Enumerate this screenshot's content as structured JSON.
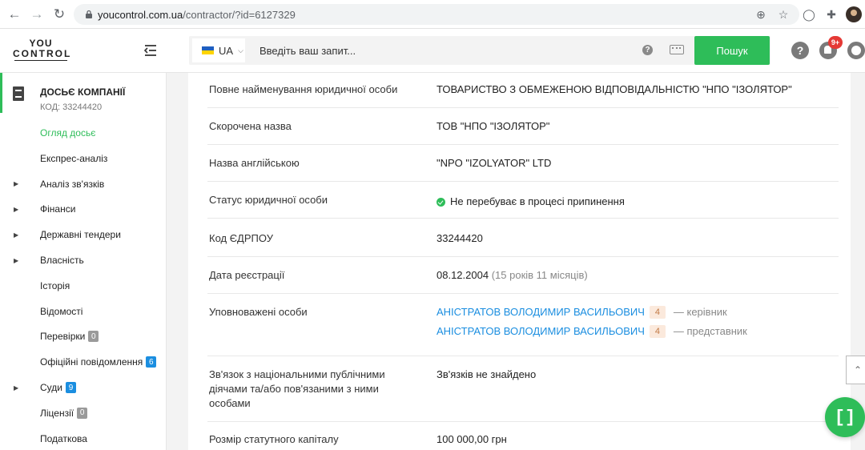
{
  "browser": {
    "url_domain": "youcontrol.com.ua",
    "url_path": "/contractor/?id=6127329"
  },
  "header": {
    "logo_line1": "YOU",
    "logo_line2": "CONTROL",
    "lang": "UA",
    "search_placeholder": "Введіть ваш запит...",
    "search_button": "Пошук",
    "help_symbol": "?",
    "notifications_badge": "9+"
  },
  "sidebar": {
    "title": "ДОСЬЄ КОМПАНІЇ",
    "code": "КОД: 33244420",
    "items": [
      {
        "label": "Огляд досьє",
        "active": true,
        "expandable": false
      },
      {
        "label": "Експрес-аналіз",
        "expandable": false
      },
      {
        "label": "Аналіз зв'язків",
        "expandable": true
      },
      {
        "label": "Фінанси",
        "expandable": true
      },
      {
        "label": "Державні тендери",
        "expandable": true
      },
      {
        "label": "Власність",
        "expandable": true
      },
      {
        "label": "Історія",
        "expandable": false
      },
      {
        "label": "Відомості",
        "expandable": false
      },
      {
        "label": "Перевірки",
        "badge": "0",
        "badge_color": "grey",
        "expandable": false
      },
      {
        "label": "Офіційні повідомлення",
        "badge": "6",
        "badge_color": "blue",
        "expandable": false
      },
      {
        "label": "Суди",
        "badge": "9",
        "badge_color": "blue",
        "expandable": true
      },
      {
        "label": "Ліцензії",
        "badge": "0",
        "badge_color": "grey",
        "expandable": false
      },
      {
        "label": "Податкова",
        "expandable": false
      }
    ]
  },
  "main": {
    "rows": [
      {
        "label": "Повне найменування юридичної особи",
        "value": "ТОВАРИСТВО З ОБМЕЖЕНОЮ ВІДПОВІДАЛЬНІСТЮ \"НПО \"ІЗОЛЯТОР\""
      },
      {
        "label": "Скорочена назва",
        "value": "ТОВ \"НПО \"ІЗОЛЯТОР\""
      },
      {
        "label": "Назва англійською",
        "value": "\"NPO \"IZOLYATOR\" LTD"
      },
      {
        "label": "Статус юридичної особи",
        "value": "Не перебуває в процесі припинення"
      },
      {
        "label": "Код ЄДРПОУ",
        "value": "33244420"
      },
      {
        "label": "Дата реєстрації",
        "value": "08.12.2004",
        "extra": "(15 років 11 місяців)"
      },
      {
        "label": "Уповноважені особи",
        "persons": [
          {
            "name": "АНІСТРАТОВ ВОЛОДИМИР ВАСИЛЬОВИЧ",
            "count": "4",
            "role": "— керівник"
          },
          {
            "name": "АНІСТРАТОВ ВОЛОДИМИР ВАСИЛЬОВИЧ",
            "count": "4",
            "role": "— представник"
          }
        ]
      },
      {
        "label_lines": [
          "Зв'язок з національними публічними",
          "діячами та/або пов'язаними з ними",
          "особами"
        ],
        "value": "Зв'язків не знайдено"
      },
      {
        "label": "Розмір статутного капіталу",
        "value": "100 000,00 грн"
      }
    ]
  },
  "colors": {
    "brand_green": "#2ebd59",
    "link_blue": "#1b8ee0",
    "badge_red": "#e53935"
  }
}
